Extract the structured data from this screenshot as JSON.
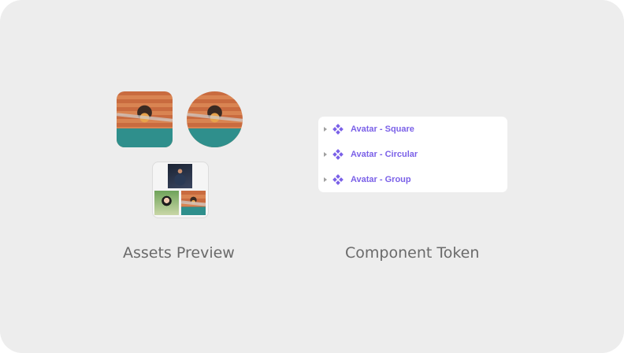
{
  "labels": {
    "assets_preview": "Assets Preview",
    "component_token": "Component Token"
  },
  "assets": {
    "square_avatar": "avatar-square",
    "circular_avatar": "avatar-circular",
    "group_avatar": "avatar-group"
  },
  "component_tree": {
    "items": [
      {
        "label": "Avatar - Square",
        "icon": "component-icon",
        "expand_icon": "caret-right-icon"
      },
      {
        "label": "Avatar - Circular",
        "icon": "component-icon",
        "expand_icon": "caret-right-icon"
      },
      {
        "label": "Avatar - Group",
        "icon": "component-icon",
        "expand_icon": "caret-right-icon"
      }
    ]
  },
  "colors": {
    "background": "#ededed",
    "component_accent": "#7b61e8",
    "label_text": "#6a6a6a"
  }
}
